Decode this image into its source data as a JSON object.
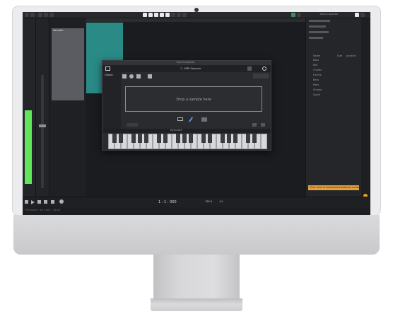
{
  "window": {
    "title": "Track Inspector",
    "status_text": "Pro Audio · 44.1 kHz · 24-bit"
  },
  "toolbar": {
    "counter": "1 : 1 : 000",
    "tempo": "120.0",
    "signature": "4/4"
  },
  "sampler": {
    "title": "1 - MIDI Sampler",
    "drop_label": "Drop a sample here",
    "mode": "Classic",
    "keyboard_label": "Keyboard",
    "track_label": "Sampler"
  },
  "browser": {
    "columns": [
      "Name",
      "Size",
      "Location"
    ],
    "items": [
      "Bass",
      "Bell",
      "Chords",
      "Drums",
      "Keys",
      "Pads",
      "Strings",
      "Synth"
    ]
  },
  "notification": {
    "text": "Click here to download additional content",
    "accent": "#f0a020"
  },
  "colors": {
    "meter": "#5fe65a",
    "region": "#2a8a86",
    "dark_bg": "#1d1e21"
  }
}
